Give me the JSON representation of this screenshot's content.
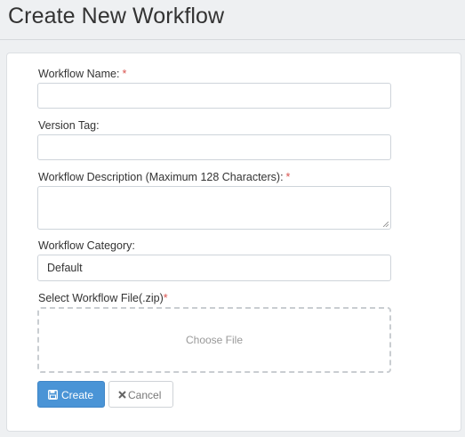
{
  "header": {
    "title": "Create New Workflow"
  },
  "form": {
    "name_label": "Workflow Name:",
    "name_required": "*",
    "name_value": "",
    "version_label": "Version Tag:",
    "version_value": "",
    "description_label": "Workflow Description (Maximum 128 Characters):",
    "description_required": "*",
    "description_value": "",
    "category_label": "Workflow Category:",
    "category_value": "Default",
    "file_label": "Select Workflow File(.zip)",
    "file_required": "*",
    "file_placeholder": "Choose File"
  },
  "buttons": {
    "create_label": "Create",
    "cancel_label": "Cancel"
  },
  "colors": {
    "primary": "#4a94d6",
    "required": "#d9534f"
  },
  "icons": {
    "create": "floppy-disk-icon",
    "cancel": "close-icon"
  }
}
